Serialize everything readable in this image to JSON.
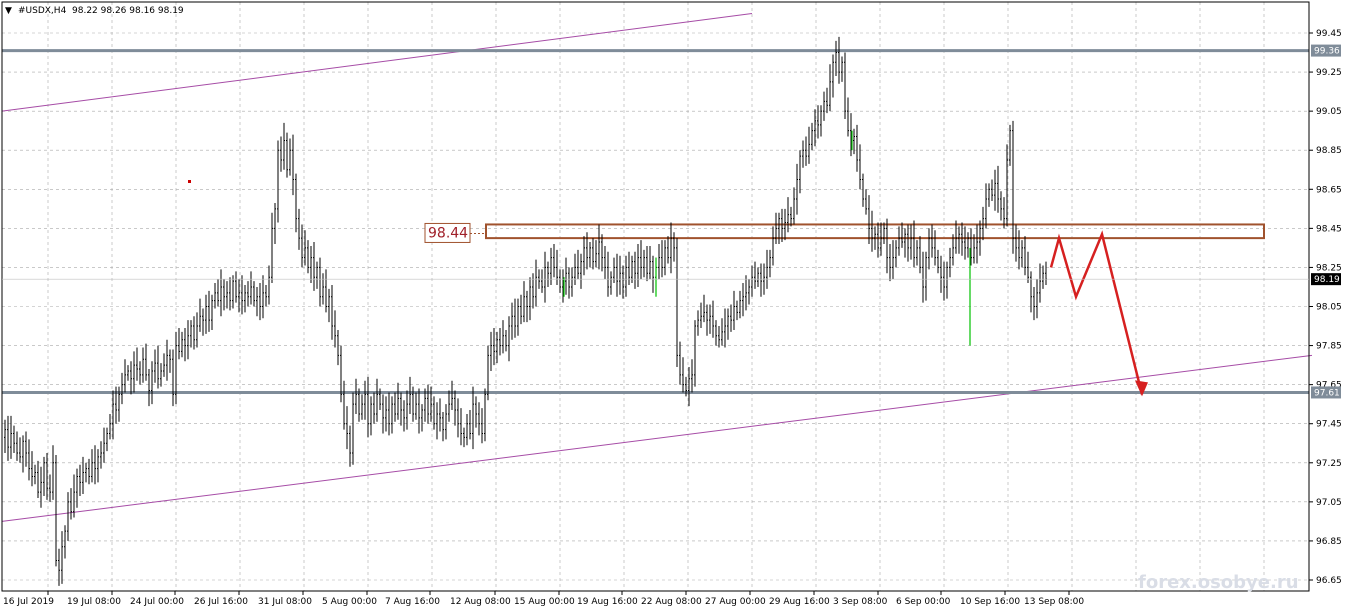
{
  "window": {
    "title": "#USDX,H4",
    "ohlc": "98.22 98.26 98.16 98.19"
  },
  "colors": {
    "background": "#ffffff",
    "grid": "#a9a9a9",
    "bar": "#000000",
    "bar_up_highlight": "#00c000",
    "channel": "#a64ca6",
    "level_line": "#7f8c99",
    "zone": "#a0522d",
    "projection": "#d62020",
    "current_price_bg": "#ffffff"
  },
  "watermark": "forex.osobye.ru",
  "chart_data": {
    "type": "candlestick-ohlc",
    "symbol": "#USDX",
    "timeframe": "H4",
    "ylim": [
      96.61,
      99.55
    ],
    "y_ticks": [
      "99.45",
      "99.25",
      "99.05",
      "98.85",
      "98.65",
      "98.45",
      "98.25",
      "98.05",
      "97.85",
      "97.65",
      "97.45",
      "97.25",
      "97.05",
      "96.85",
      "96.65"
    ],
    "x_ticks": [
      "16 Jul 2019",
      "19 Jul 08:00",
      "24 Jul 00:00",
      "26 Jul 16:00",
      "31 Jul 08:00",
      "5 Aug 00:00",
      "7 Aug 16:00",
      "12 Aug 08:00",
      "15 Aug 00:00",
      "19 Aug 16:00",
      "22 Aug 08:00",
      "27 Aug 00:00",
      "29 Aug 16:00",
      "3 Sep 08:00",
      "6 Sep 00:00",
      "10 Sep 16:00",
      "13 Sep 08:00"
    ],
    "grid": true,
    "price_path": [
      [
        0,
        97.38
      ],
      [
        3,
        97.42
      ],
      [
        6,
        97.33
      ],
      [
        9,
        97.4
      ],
      [
        12,
        97.35
      ],
      [
        15,
        97.3
      ],
      [
        18,
        97.28
      ],
      [
        21,
        97.36
      ],
      [
        24,
        97.3
      ],
      [
        27,
        97.22
      ],
      [
        30,
        97.18
      ],
      [
        33,
        97.2
      ],
      [
        36,
        97.1
      ],
      [
        39,
        97.15
      ],
      [
        42,
        97.25
      ],
      [
        45,
        97.12
      ],
      [
        48,
        97.1
      ],
      [
        51,
        97.25
      ],
      [
        54,
        96.75
      ],
      [
        57,
        96.7
      ],
      [
        60,
        96.82
      ],
      [
        63,
        96.9
      ],
      [
        66,
        97.05
      ],
      [
        69,
        97.0
      ],
      [
        72,
        97.1
      ],
      [
        75,
        97.18
      ],
      [
        78,
        97.15
      ],
      [
        81,
        97.2
      ],
      [
        84,
        97.22
      ],
      [
        87,
        97.18
      ],
      [
        90,
        97.25
      ],
      [
        93,
        97.22
      ],
      [
        96,
        97.28
      ],
      [
        99,
        97.3
      ],
      [
        102,
        97.35
      ],
      [
        105,
        97.4
      ],
      [
        108,
        97.45
      ],
      [
        111,
        97.55
      ],
      [
        114,
        97.52
      ],
      [
        117,
        97.6
      ],
      [
        120,
        97.65
      ],
      [
        123,
        97.7
      ],
      [
        126,
        97.72
      ],
      [
        129,
        97.68
      ],
      [
        132,
        97.75
      ],
      [
        135,
        97.73
      ],
      [
        138,
        97.7
      ],
      [
        141,
        97.78
      ],
      [
        144,
        97.7
      ],
      [
        147,
        97.62
      ],
      [
        150,
        97.72
      ],
      [
        153,
        97.76
      ],
      [
        156,
        97.68
      ],
      [
        159,
        97.72
      ],
      [
        162,
        97.75
      ],
      [
        165,
        97.8
      ],
      [
        168,
        97.78
      ],
      [
        171,
        97.6
      ],
      [
        174,
        97.85
      ],
      [
        177,
        97.82
      ],
      [
        180,
        97.88
      ],
      [
        183,
        97.85
      ],
      [
        186,
        97.9
      ],
      [
        189,
        97.95
      ],
      [
        192,
        97.88
      ],
      [
        195,
        97.95
      ],
      [
        198,
        98.0
      ],
      [
        201,
        97.98
      ],
      [
        204,
        98.05
      ],
      [
        207,
        97.98
      ],
      [
        210,
        98.08
      ],
      [
        213,
        98.12
      ],
      [
        216,
        98.08
      ],
      [
        219,
        98.15
      ],
      [
        222,
        98.1
      ],
      [
        225,
        98.12
      ],
      [
        228,
        98.08
      ],
      [
        231,
        98.18
      ],
      [
        234,
        98.1
      ],
      [
        237,
        98.12
      ],
      [
        240,
        98.08
      ],
      [
        243,
        98.12
      ],
      [
        246,
        98.1
      ],
      [
        249,
        98.15
      ],
      [
        252,
        98.08
      ],
      [
        255,
        98.1
      ],
      [
        258,
        98.05
      ],
      [
        261,
        98.12
      ],
      [
        264,
        98.1
      ],
      [
        267,
        98.2
      ],
      [
        270,
        98.45
      ],
      [
        273,
        98.55
      ],
      [
        276,
        98.85
      ],
      [
        279,
        98.8
      ],
      [
        282,
        98.9
      ],
      [
        285,
        98.75
      ],
      [
        288,
        98.85
      ],
      [
        291,
        98.7
      ],
      [
        294,
        98.5
      ],
      [
        297,
        98.4
      ],
      [
        300,
        98.3
      ],
      [
        303,
        98.35
      ],
      [
        306,
        98.25
      ],
      [
        309,
        98.3
      ],
      [
        312,
        98.2
      ],
      [
        315,
        98.25
      ],
      [
        318,
        98.1
      ],
      [
        321,
        98.15
      ],
      [
        324,
        98.05
      ],
      [
        327,
        98.1
      ],
      [
        330,
        97.95
      ],
      [
        333,
        97.9
      ],
      [
        336,
        97.8
      ],
      [
        339,
        97.6
      ],
      [
        342,
        97.45
      ],
      [
        345,
        97.4
      ],
      [
        348,
        97.3
      ],
      [
        351,
        97.55
      ],
      [
        354,
        97.6
      ],
      [
        357,
        97.5
      ],
      [
        360,
        97.55
      ],
      [
        363,
        97.6
      ],
      [
        366,
        97.45
      ],
      [
        369,
        97.55
      ],
      [
        372,
        97.5
      ],
      [
        375,
        97.6
      ],
      [
        378,
        97.55
      ],
      [
        381,
        97.48
      ],
      [
        384,
        97.52
      ],
      [
        387,
        97.45
      ],
      [
        390,
        97.55
      ],
      [
        393,
        97.5
      ],
      [
        396,
        97.58
      ],
      [
        399,
        97.52
      ],
      [
        402,
        97.48
      ],
      [
        405,
        97.55
      ],
      [
        408,
        97.6
      ],
      [
        411,
        97.5
      ],
      [
        414,
        97.55
      ],
      [
        417,
        97.48
      ],
      [
        420,
        97.52
      ],
      [
        423,
        97.58
      ],
      [
        426,
        97.5
      ],
      [
        429,
        97.55
      ],
      [
        432,
        97.45
      ],
      [
        435,
        97.5
      ],
      [
        438,
        97.48
      ],
      [
        441,
        97.42
      ],
      [
        444,
        97.5
      ],
      [
        447,
        97.55
      ],
      [
        450,
        97.58
      ],
      [
        453,
        97.52
      ],
      [
        456,
        97.45
      ],
      [
        459,
        97.4
      ],
      [
        462,
        97.38
      ],
      [
        465,
        97.45
      ],
      [
        468,
        97.4
      ],
      [
        471,
        97.55
      ],
      [
        474,
        97.5
      ],
      [
        477,
        97.45
      ],
      [
        480,
        97.4
      ],
      [
        483,
        97.6
      ],
      [
        486,
        97.8
      ],
      [
        489,
        97.85
      ],
      [
        492,
        97.82
      ],
      [
        495,
        97.88
      ],
      [
        498,
        97.85
      ],
      [
        501,
        97.9
      ],
      [
        504,
        97.85
      ],
      [
        507,
        97.95
      ],
      [
        510,
        98.0
      ],
      [
        513,
        97.95
      ],
      [
        516,
        98.05
      ],
      [
        519,
        98.0
      ],
      [
        522,
        98.1
      ],
      [
        525,
        98.05
      ],
      [
        528,
        98.15
      ],
      [
        531,
        98.1
      ],
      [
        534,
        98.2
      ],
      [
        537,
        98.18
      ],
      [
        540,
        98.15
      ],
      [
        543,
        98.25
      ],
      [
        546,
        98.22
      ],
      [
        549,
        98.3
      ],
      [
        552,
        98.25
      ],
      [
        555,
        98.2
      ],
      [
        558,
        98.15
      ],
      [
        561,
        98.18
      ],
      [
        564,
        98.22
      ],
      [
        567,
        98.15
      ],
      [
        570,
        98.2
      ],
      [
        573,
        98.25
      ],
      [
        576,
        98.22
      ],
      [
        579,
        98.28
      ],
      [
        582,
        98.35
      ],
      [
        585,
        98.3
      ],
      [
        588,
        98.35
      ],
      [
        591,
        98.28
      ],
      [
        594,
        98.32
      ],
      [
        597,
        98.38
      ],
      [
        600,
        98.3
      ],
      [
        603,
        98.25
      ],
      [
        606,
        98.15
      ],
      [
        609,
        98.2
      ],
      [
        612,
        98.25
      ],
      [
        615,
        98.18
      ],
      [
        618,
        98.22
      ],
      [
        621,
        98.15
      ],
      [
        624,
        98.25
      ],
      [
        627,
        98.2
      ],
      [
        630,
        98.28
      ],
      [
        633,
        98.22
      ],
      [
        636,
        98.3
      ],
      [
        639,
        98.25
      ],
      [
        642,
        98.3
      ],
      [
        645,
        98.22
      ],
      [
        648,
        98.28
      ],
      [
        651,
        98.2
      ],
      [
        654,
        98.25
      ],
      [
        657,
        98.3
      ],
      [
        660,
        98.25
      ],
      [
        663,
        98.35
      ],
      [
        666,
        98.3
      ],
      [
        669,
        98.4
      ],
      [
        672,
        98.35
      ],
      [
        675,
        97.8
      ],
      [
        678,
        97.7
      ],
      [
        681,
        97.65
      ],
      [
        684,
        97.62
      ],
      [
        687,
        97.68
      ],
      [
        690,
        97.7
      ],
      [
        693,
        97.95
      ],
      [
        696,
        97.98
      ],
      [
        699,
        98.0
      ],
      [
        702,
        98.02
      ],
      [
        705,
        97.98
      ],
      [
        708,
        98.0
      ],
      [
        711,
        97.95
      ],
      [
        714,
        97.9
      ],
      [
        717,
        97.88
      ],
      [
        720,
        97.92
      ],
      [
        723,
        97.95
      ],
      [
        726,
        98.0
      ],
      [
        729,
        97.98
      ],
      [
        732,
        98.05
      ],
      [
        735,
        98.02
      ],
      [
        738,
        98.08
      ],
      [
        741,
        98.1
      ],
      [
        744,
        98.12
      ],
      [
        747,
        98.15
      ],
      [
        750,
        98.2
      ],
      [
        753,
        98.18
      ],
      [
        756,
        98.22
      ],
      [
        759,
        98.18
      ],
      [
        762,
        98.2
      ],
      [
        765,
        98.25
      ],
      [
        768,
        98.3
      ],
      [
        771,
        98.4
      ],
      [
        774,
        98.45
      ],
      [
        777,
        98.5
      ],
      [
        780,
        98.45
      ],
      [
        783,
        98.48
      ],
      [
        786,
        98.52
      ],
      [
        789,
        98.5
      ],
      [
        792,
        98.6
      ],
      [
        795,
        98.7
      ],
      [
        798,
        98.82
      ],
      [
        801,
        98.85
      ],
      [
        804,
        98.82
      ],
      [
        807,
        98.88
      ],
      [
        810,
        98.95
      ],
      [
        813,
        99.0
      ],
      [
        816,
        98.98
      ],
      [
        819,
        99.05
      ],
      [
        822,
        99.1
      ],
      [
        825,
        99.08
      ],
      [
        828,
        99.2
      ],
      [
        831,
        99.3
      ],
      [
        834,
        99.35
      ],
      [
        837,
        99.25
      ],
      [
        840,
        99.3
      ],
      [
        843,
        99.05
      ],
      [
        846,
        98.95
      ],
      [
        849,
        98.9
      ],
      [
        852,
        98.92
      ],
      [
        855,
        98.8
      ],
      [
        858,
        98.7
      ],
      [
        861,
        98.6
      ],
      [
        864,
        98.55
      ],
      [
        867,
        98.45
      ],
      [
        870,
        98.4
      ],
      [
        873,
        98.42
      ],
      [
        876,
        98.35
      ],
      [
        879,
        98.4
      ],
      [
        882,
        98.45
      ],
      [
        885,
        98.3
      ],
      [
        888,
        98.25
      ],
      [
        891,
        98.3
      ],
      [
        894,
        98.35
      ],
      [
        897,
        98.4
      ],
      [
        900,
        98.38
      ],
      [
        903,
        98.42
      ],
      [
        906,
        98.35
      ],
      [
        909,
        98.4
      ],
      [
        912,
        98.3
      ],
      [
        915,
        98.35
      ],
      [
        918,
        98.25
      ],
      [
        921,
        98.15
      ],
      [
        924,
        98.3
      ],
      [
        927,
        98.4
      ],
      [
        930,
        98.35
      ],
      [
        933,
        98.3
      ],
      [
        936,
        98.25
      ],
      [
        939,
        98.2
      ],
      [
        942,
        98.15
      ],
      [
        945,
        98.25
      ],
      [
        948,
        98.3
      ],
      [
        951,
        98.35
      ],
      [
        954,
        98.4
      ],
      [
        957,
        98.42
      ],
      [
        960,
        98.38
      ],
      [
        963,
        98.35
      ],
      [
        966,
        98.4
      ],
      [
        969,
        98.3
      ],
      [
        972,
        98.35
      ],
      [
        975,
        98.38
      ],
      [
        978,
        98.45
      ],
      [
        981,
        98.5
      ],
      [
        984,
        98.6
      ],
      [
        987,
        98.65
      ],
      [
        990,
        98.62
      ],
      [
        993,
        98.68
      ],
      [
        996,
        98.6
      ],
      [
        999,
        98.55
      ],
      [
        1002,
        98.5
      ],
      [
        1005,
        98.8
      ],
      [
        1008,
        98.95
      ],
      [
        1011,
        98.4
      ],
      [
        1014,
        98.35
      ],
      [
        1017,
        98.3
      ],
      [
        1020,
        98.35
      ],
      [
        1023,
        98.25
      ],
      [
        1026,
        98.2
      ],
      [
        1029,
        98.1
      ],
      [
        1032,
        98.05
      ],
      [
        1035,
        98.12
      ],
      [
        1038,
        98.18
      ],
      [
        1041,
        98.22
      ],
      [
        1044,
        98.19
      ]
    ],
    "horizontal_levels": [
      {
        "label": "99.36",
        "value": 99.36
      },
      {
        "label": "97.61",
        "value": 97.61
      }
    ],
    "current_price": {
      "label": "98.19",
      "value": 98.19
    },
    "resistance_zone": {
      "label": "98.44",
      "top": 98.47,
      "bottom": 98.4
    },
    "channel": {
      "upper": [
        [
          0,
          99.05
        ],
        [
          750,
          99.55
        ]
      ],
      "lower": [
        [
          0,
          96.95
        ],
        [
          1310,
          97.8
        ]
      ]
    },
    "projection_path": [
      [
        1049,
        98.25
      ],
      [
        1057,
        98.4
      ],
      [
        1074,
        98.1
      ],
      [
        1100,
        98.42
      ],
      [
        1140,
        97.6
      ]
    ]
  }
}
